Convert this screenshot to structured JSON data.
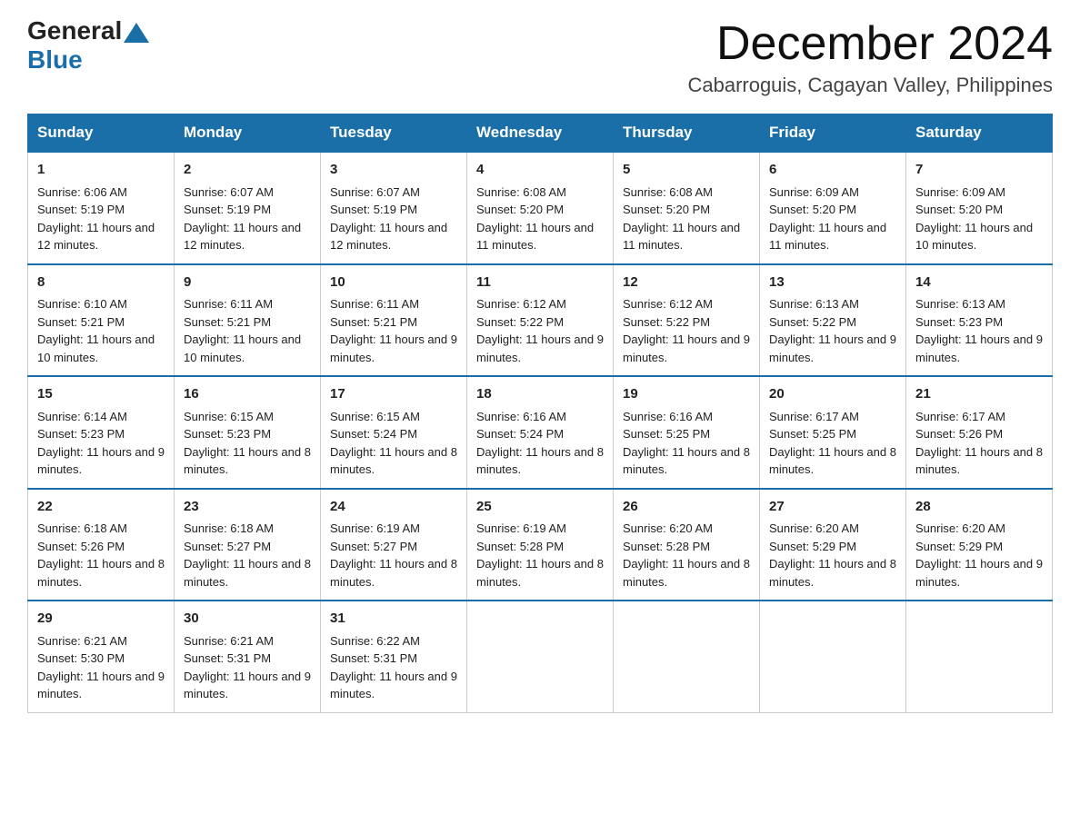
{
  "logo": {
    "general": "General",
    "blue": "Blue"
  },
  "title": {
    "month": "December 2024",
    "location": "Cabarroguis, Cagayan Valley, Philippines"
  },
  "headers": [
    "Sunday",
    "Monday",
    "Tuesday",
    "Wednesday",
    "Thursday",
    "Friday",
    "Saturday"
  ],
  "weeks": [
    [
      {
        "day": "1",
        "sunrise": "6:06 AM",
        "sunset": "5:19 PM",
        "daylight": "11 hours and 12 minutes."
      },
      {
        "day": "2",
        "sunrise": "6:07 AM",
        "sunset": "5:19 PM",
        "daylight": "11 hours and 12 minutes."
      },
      {
        "day": "3",
        "sunrise": "6:07 AM",
        "sunset": "5:19 PM",
        "daylight": "11 hours and 12 minutes."
      },
      {
        "day": "4",
        "sunrise": "6:08 AM",
        "sunset": "5:20 PM",
        "daylight": "11 hours and 11 minutes."
      },
      {
        "day": "5",
        "sunrise": "6:08 AM",
        "sunset": "5:20 PM",
        "daylight": "11 hours and 11 minutes."
      },
      {
        "day": "6",
        "sunrise": "6:09 AM",
        "sunset": "5:20 PM",
        "daylight": "11 hours and 11 minutes."
      },
      {
        "day": "7",
        "sunrise": "6:09 AM",
        "sunset": "5:20 PM",
        "daylight": "11 hours and 10 minutes."
      }
    ],
    [
      {
        "day": "8",
        "sunrise": "6:10 AM",
        "sunset": "5:21 PM",
        "daylight": "11 hours and 10 minutes."
      },
      {
        "day": "9",
        "sunrise": "6:11 AM",
        "sunset": "5:21 PM",
        "daylight": "11 hours and 10 minutes."
      },
      {
        "day": "10",
        "sunrise": "6:11 AM",
        "sunset": "5:21 PM",
        "daylight": "11 hours and 9 minutes."
      },
      {
        "day": "11",
        "sunrise": "6:12 AM",
        "sunset": "5:22 PM",
        "daylight": "11 hours and 9 minutes."
      },
      {
        "day": "12",
        "sunrise": "6:12 AM",
        "sunset": "5:22 PM",
        "daylight": "11 hours and 9 minutes."
      },
      {
        "day": "13",
        "sunrise": "6:13 AM",
        "sunset": "5:22 PM",
        "daylight": "11 hours and 9 minutes."
      },
      {
        "day": "14",
        "sunrise": "6:13 AM",
        "sunset": "5:23 PM",
        "daylight": "11 hours and 9 minutes."
      }
    ],
    [
      {
        "day": "15",
        "sunrise": "6:14 AM",
        "sunset": "5:23 PM",
        "daylight": "11 hours and 9 minutes."
      },
      {
        "day": "16",
        "sunrise": "6:15 AM",
        "sunset": "5:23 PM",
        "daylight": "11 hours and 8 minutes."
      },
      {
        "day": "17",
        "sunrise": "6:15 AM",
        "sunset": "5:24 PM",
        "daylight": "11 hours and 8 minutes."
      },
      {
        "day": "18",
        "sunrise": "6:16 AM",
        "sunset": "5:24 PM",
        "daylight": "11 hours and 8 minutes."
      },
      {
        "day": "19",
        "sunrise": "6:16 AM",
        "sunset": "5:25 PM",
        "daylight": "11 hours and 8 minutes."
      },
      {
        "day": "20",
        "sunrise": "6:17 AM",
        "sunset": "5:25 PM",
        "daylight": "11 hours and 8 minutes."
      },
      {
        "day": "21",
        "sunrise": "6:17 AM",
        "sunset": "5:26 PM",
        "daylight": "11 hours and 8 minutes."
      }
    ],
    [
      {
        "day": "22",
        "sunrise": "6:18 AM",
        "sunset": "5:26 PM",
        "daylight": "11 hours and 8 minutes."
      },
      {
        "day": "23",
        "sunrise": "6:18 AM",
        "sunset": "5:27 PM",
        "daylight": "11 hours and 8 minutes."
      },
      {
        "day": "24",
        "sunrise": "6:19 AM",
        "sunset": "5:27 PM",
        "daylight": "11 hours and 8 minutes."
      },
      {
        "day": "25",
        "sunrise": "6:19 AM",
        "sunset": "5:28 PM",
        "daylight": "11 hours and 8 minutes."
      },
      {
        "day": "26",
        "sunrise": "6:20 AM",
        "sunset": "5:28 PM",
        "daylight": "11 hours and 8 minutes."
      },
      {
        "day": "27",
        "sunrise": "6:20 AM",
        "sunset": "5:29 PM",
        "daylight": "11 hours and 8 minutes."
      },
      {
        "day": "28",
        "sunrise": "6:20 AM",
        "sunset": "5:29 PM",
        "daylight": "11 hours and 9 minutes."
      }
    ],
    [
      {
        "day": "29",
        "sunrise": "6:21 AM",
        "sunset": "5:30 PM",
        "daylight": "11 hours and 9 minutes."
      },
      {
        "day": "30",
        "sunrise": "6:21 AM",
        "sunset": "5:31 PM",
        "daylight": "11 hours and 9 minutes."
      },
      {
        "day": "31",
        "sunrise": "6:22 AM",
        "sunset": "5:31 PM",
        "daylight": "11 hours and 9 minutes."
      },
      null,
      null,
      null,
      null
    ]
  ]
}
